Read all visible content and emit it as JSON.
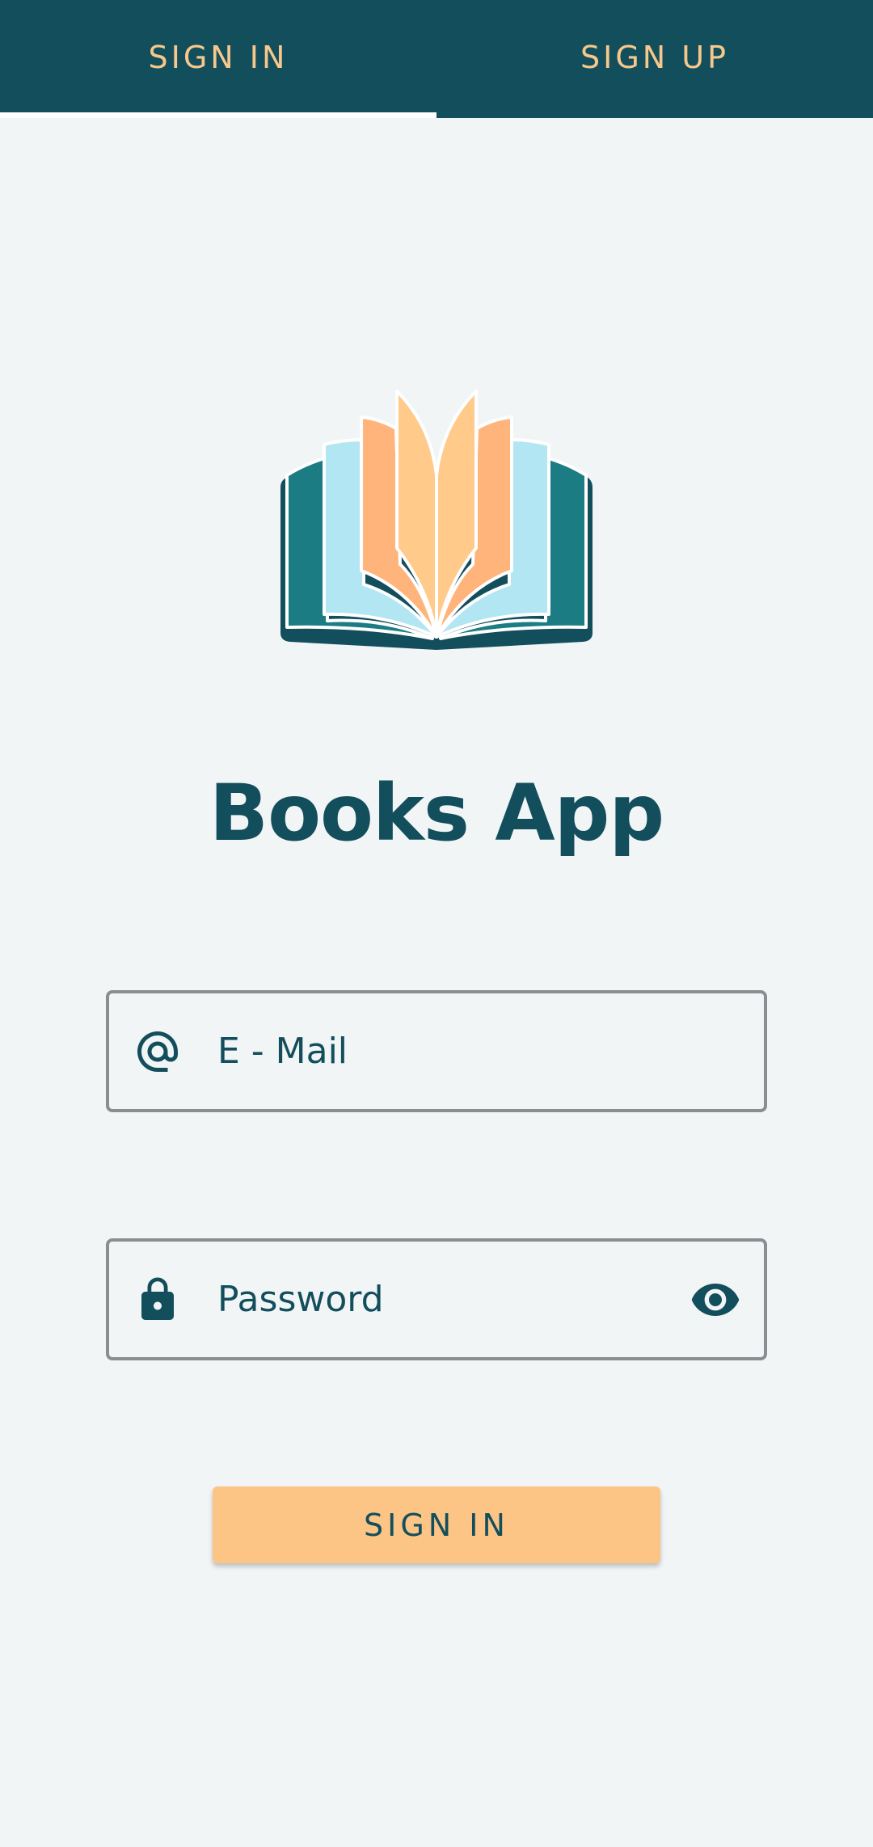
{
  "tabs": [
    {
      "label": "SIGN IN",
      "selected": true
    },
    {
      "label": "SIGN UP",
      "selected": false
    }
  ],
  "app": {
    "title": "Books App",
    "logo_icon": "open-book-icon"
  },
  "form": {
    "email": {
      "placeholder": "E - Mail",
      "value": "",
      "icon": "at-sign-icon"
    },
    "password": {
      "placeholder": "Password",
      "value": "",
      "icon": "lock-icon",
      "toggle_icon": "eye-icon"
    },
    "submit_label": "SIGN IN"
  },
  "colors": {
    "primary": "#134e5c",
    "accent": "#f7c88b",
    "button": "#fcc585",
    "background": "#f1f5f6",
    "book_teal": "#1b7c84",
    "book_light_blue": "#b3e6f3",
    "book_orange": "#ffb47b",
    "book_light_orange": "#ffca8a"
  }
}
